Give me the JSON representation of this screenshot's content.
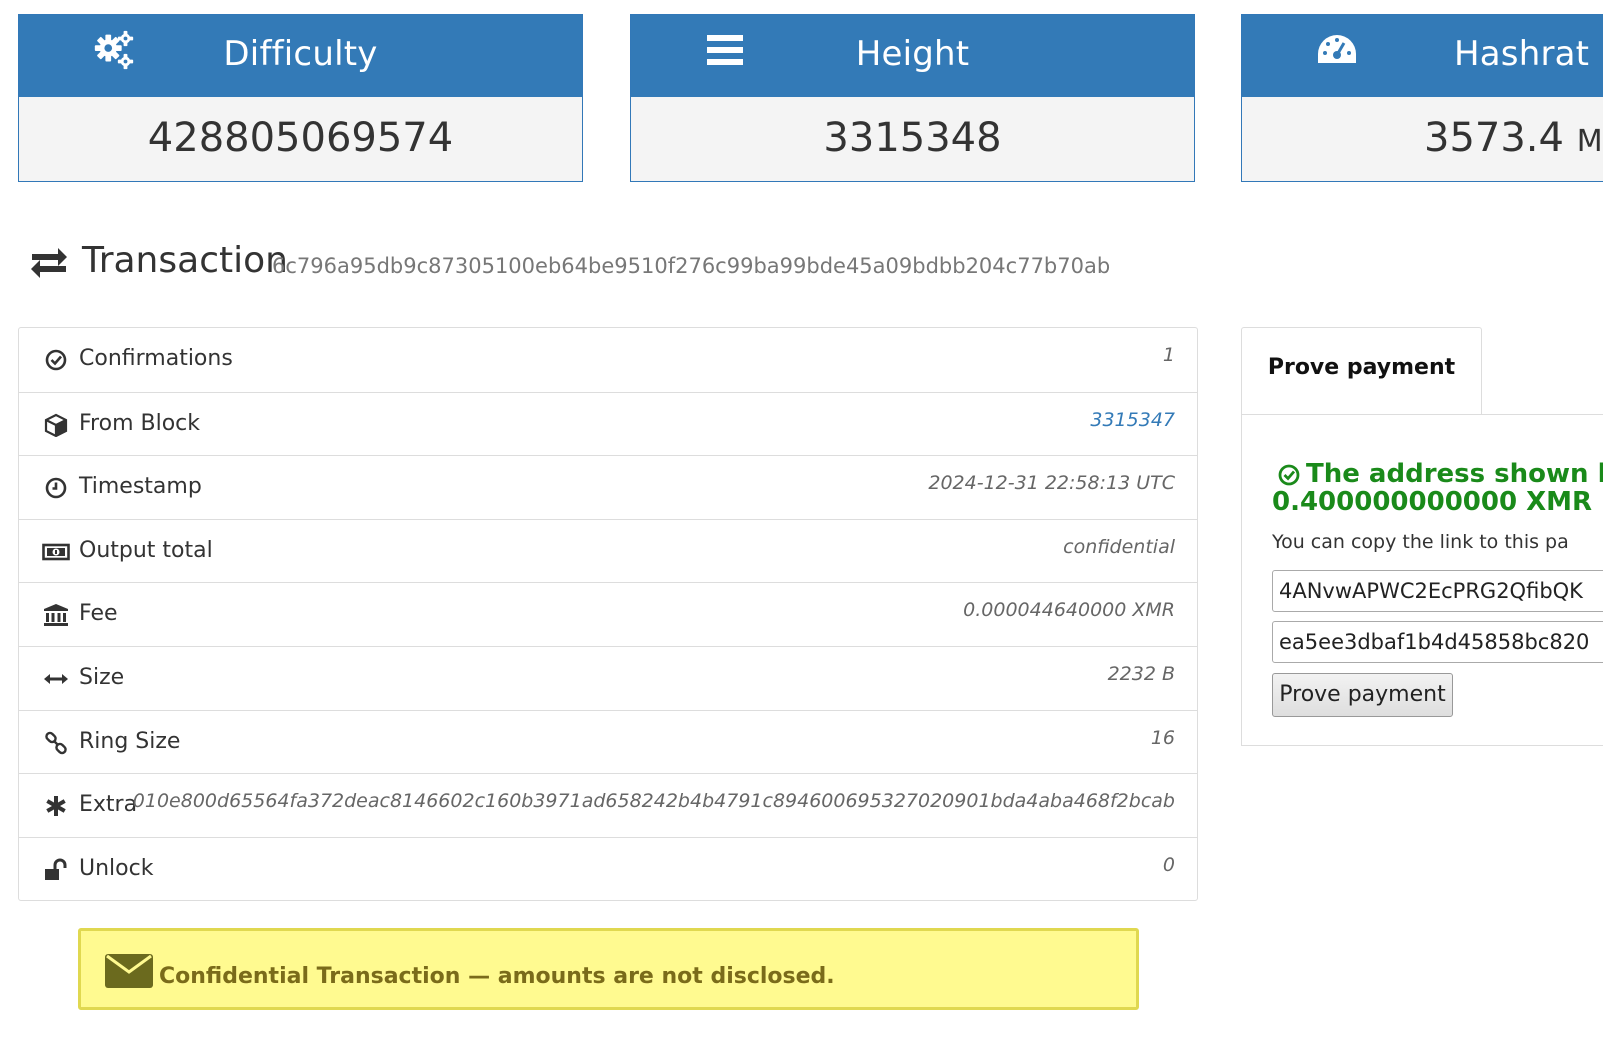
{
  "stats": [
    {
      "title": "Difficulty",
      "value": "428805069574",
      "unit": "",
      "icon": "gears-icon"
    },
    {
      "title": "Height",
      "value": "3315348",
      "unit": "",
      "icon": "bars-icon"
    },
    {
      "title": "Hashrat",
      "value": "3573.4",
      "unit": "M",
      "icon": "tachometer-icon"
    }
  ],
  "transaction": {
    "title": "Transaction",
    "hash": "6c796a95db9c87305100eb64be9510f276c99ba99bde45a09bdbb204c77b70ab"
  },
  "details": [
    {
      "label": "Confirmations",
      "value": "1",
      "icon": "check-circle-icon"
    },
    {
      "label": "From Block",
      "value": "3315347",
      "icon": "cube-icon",
      "link": true
    },
    {
      "label": "Timestamp",
      "value": "2024-12-31 22:58:13 UTC",
      "icon": "clock-icon"
    },
    {
      "label": "Output total",
      "value": "confidential",
      "icon": "money-icon"
    },
    {
      "label": "Fee",
      "value": "0.000044640000 XMR",
      "icon": "bank-icon"
    },
    {
      "label": "Size",
      "value": "2232 B",
      "icon": "arrows-h-icon"
    },
    {
      "label": "Ring Size",
      "value": "16",
      "icon": "chain-icon"
    },
    {
      "label": "Extra",
      "value": "010e800d65564fa372deac8146602c160b3971ad658242b4b4791c894600695327020901bda4aba468f2bcab",
      "icon": "asterisk-icon"
    },
    {
      "label": "Unlock",
      "value": "0",
      "icon": "unlock-icon"
    }
  ],
  "prove": {
    "tab_label": "Prove payment",
    "success_line1": "The address shown b",
    "success_line2": "0.400000000000 XMR",
    "copy_text": "You can copy the link to this pa",
    "address_value": "4ANvwAPWC2EcPRG2QfibQK",
    "key_value": "ea5ee3dbaf1b4d45858bc820",
    "button_label": "Prove payment"
  },
  "notice": {
    "text": "Confidential Transaction — amounts are not disclosed."
  },
  "colors": {
    "primary": "#337ab7",
    "success": "#1a8a1a",
    "notice_bg": "#fffa90",
    "notice_text": "#7a6b1a"
  }
}
